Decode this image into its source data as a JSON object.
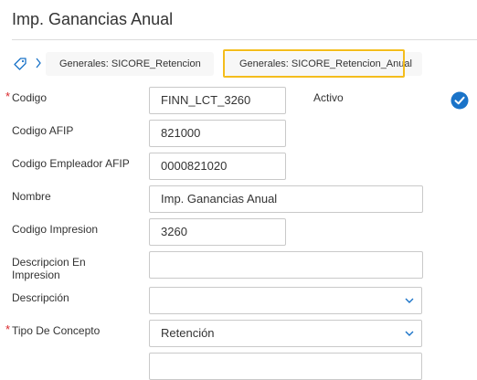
{
  "header": {
    "title": "Imp. Ganancias Anual"
  },
  "breadcrumb": {
    "items": [
      {
        "label": "Generales: SICORE_Retencion"
      },
      {
        "label": "Generales: SICORE_Retencion_Anual"
      }
    ],
    "highlight_color": "#f4bd1d"
  },
  "form": {
    "required_marker": "*",
    "codigo": {
      "label": "Codigo",
      "value": "FINN_LCT_3260",
      "required": true
    },
    "activo": {
      "label": "Activo",
      "checked": true,
      "icon": "check-circle-icon",
      "color": "#1a73c8"
    },
    "codigo_afip": {
      "label": "Codigo AFIP",
      "value": "821000"
    },
    "codigo_empleador_afip": {
      "label": "Codigo Empleador AFIP",
      "value": "0000821020"
    },
    "nombre": {
      "label": "Nombre",
      "value": "Imp. Ganancias Anual"
    },
    "codigo_impresion": {
      "label": "Codigo Impresion",
      "value": "3260"
    },
    "descripcion_en_impresion": {
      "label_line1": "Descripcion En",
      "label_line2": "Impresion",
      "value": ""
    },
    "descripcion": {
      "label": "Descripción",
      "value": ""
    },
    "tipo_de_concepto": {
      "label": "Tipo De Concepto",
      "value": "Retención",
      "required": true
    }
  },
  "colors": {
    "required": "#d9262a",
    "field_border": "#c9c9c9",
    "accent": "#1a73c8"
  }
}
